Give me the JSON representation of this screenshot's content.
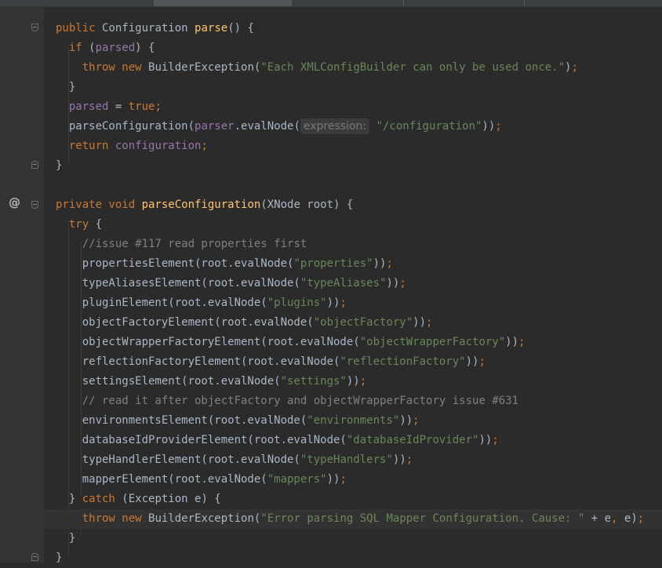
{
  "tabs": [
    "",
    "",
    "",
    "",
    ""
  ],
  "gutter": {
    "override_marker": "@"
  },
  "lines": [
    [
      [
        "kw",
        "public "
      ],
      [
        "",
        "Configuration "
      ],
      [
        "fn",
        "parse"
      ],
      [
        "",
        "() {"
      ]
    ],
    [
      [
        "",
        "  "
      ],
      [
        "kw",
        "if "
      ],
      [
        "",
        "("
      ],
      [
        "field",
        "parsed"
      ],
      [
        "",
        ") {"
      ]
    ],
    [
      [
        "",
        "    "
      ],
      [
        "kw",
        "throw new "
      ],
      [
        "",
        "BuilderException("
      ],
      [
        "str",
        "\"Each XMLConfigBuilder can only be used once.\""
      ],
      [
        "",
        ")"
      ],
      [
        "kw",
        ";"
      ]
    ],
    [
      [
        "",
        "  }"
      ]
    ],
    [
      [
        "",
        "  "
      ],
      [
        "field",
        "parsed"
      ],
      [
        "",
        " = "
      ],
      [
        "kw",
        "true;"
      ]
    ],
    [
      [
        "",
        "  parseConfiguration("
      ],
      [
        "field",
        "parser"
      ],
      [
        "",
        ".evalNode("
      ],
      [
        "hint",
        "expression:"
      ],
      [
        "str",
        " \"/configuration\""
      ],
      [
        "",
        "))"
      ],
      [
        "kw",
        ";"
      ]
    ],
    [
      [
        "",
        "  "
      ],
      [
        "kw",
        "return "
      ],
      [
        "field",
        "configuration"
      ],
      [
        "kw",
        ";"
      ]
    ],
    [
      [
        "",
        "}"
      ]
    ],
    [],
    [
      [
        "kw",
        "private void "
      ],
      [
        "fn",
        "parseConfiguration"
      ],
      [
        "",
        "(XNode root) {"
      ]
    ],
    [
      [
        "",
        "  "
      ],
      [
        "kw",
        "try "
      ],
      [
        "",
        "{"
      ]
    ],
    [
      [
        "",
        "    "
      ],
      [
        "cmt",
        "//issue #117 read properties first"
      ]
    ],
    [
      [
        "",
        "    propertiesElement(root.evalNode("
      ],
      [
        "str",
        "\"properties\""
      ],
      [
        "",
        "))"
      ],
      [
        "kw",
        ";"
      ]
    ],
    [
      [
        "",
        "    typeAliasesElement(root.evalNode("
      ],
      [
        "str",
        "\"typeAliases\""
      ],
      [
        "",
        "))"
      ],
      [
        "kw",
        ";"
      ]
    ],
    [
      [
        "",
        "    pluginElement(root.evalNode("
      ],
      [
        "str",
        "\"plugins\""
      ],
      [
        "",
        "))"
      ],
      [
        "kw",
        ";"
      ]
    ],
    [
      [
        "",
        "    objectFactoryElement(root.evalNode("
      ],
      [
        "str",
        "\"objectFactory\""
      ],
      [
        "",
        "))"
      ],
      [
        "kw",
        ";"
      ]
    ],
    [
      [
        "",
        "    objectWrapperFactoryElement(root.evalNode("
      ],
      [
        "str",
        "\"objectWrapperFactory\""
      ],
      [
        "",
        "))"
      ],
      [
        "kw",
        ";"
      ]
    ],
    [
      [
        "",
        "    reflectionFactoryElement(root.evalNode("
      ],
      [
        "str",
        "\"reflectionFactory\""
      ],
      [
        "",
        "))"
      ],
      [
        "kw",
        ";"
      ]
    ],
    [
      [
        "",
        "    settingsElement(root.evalNode("
      ],
      [
        "str",
        "\"settings\""
      ],
      [
        "",
        "))"
      ],
      [
        "kw",
        ";"
      ]
    ],
    [
      [
        "",
        "    "
      ],
      [
        "cmt",
        "// read it after objectFactory and objectWrapperFactory issue #631"
      ]
    ],
    [
      [
        "",
        "    environmentsElement(root.evalNode("
      ],
      [
        "str",
        "\"environments\""
      ],
      [
        "",
        "))"
      ],
      [
        "kw",
        ";"
      ]
    ],
    [
      [
        "",
        "    databaseIdProviderElement(root.evalNode("
      ],
      [
        "str",
        "\"databaseIdProvider\""
      ],
      [
        "",
        "))"
      ],
      [
        "kw",
        ";"
      ]
    ],
    [
      [
        "",
        "    typeHandlerElement(root.evalNode("
      ],
      [
        "str",
        "\"typeHandlers\""
      ],
      [
        "",
        "))"
      ],
      [
        "kw",
        ";"
      ]
    ],
    [
      [
        "",
        "    mapperElement(root.evalNode("
      ],
      [
        "str",
        "\"mappers\""
      ],
      [
        "",
        "))"
      ],
      [
        "kw",
        ";"
      ]
    ],
    [
      [
        "",
        "  } "
      ],
      [
        "kw",
        "catch "
      ],
      [
        "",
        "(Exception e) {"
      ]
    ],
    [
      [
        "",
        "    "
      ],
      [
        "kw",
        "throw new "
      ],
      [
        "",
        "BuilderException("
      ],
      [
        "str",
        "\"Error parsing SQL Mapper Configuration. Cause: \""
      ],
      [
        "",
        " + e"
      ],
      [
        "kw",
        ", "
      ],
      [
        "",
        "e)"
      ],
      [
        "kw",
        ";"
      ]
    ],
    [
      [
        "",
        "  }"
      ]
    ],
    [
      [
        "",
        "}"
      ]
    ]
  ]
}
